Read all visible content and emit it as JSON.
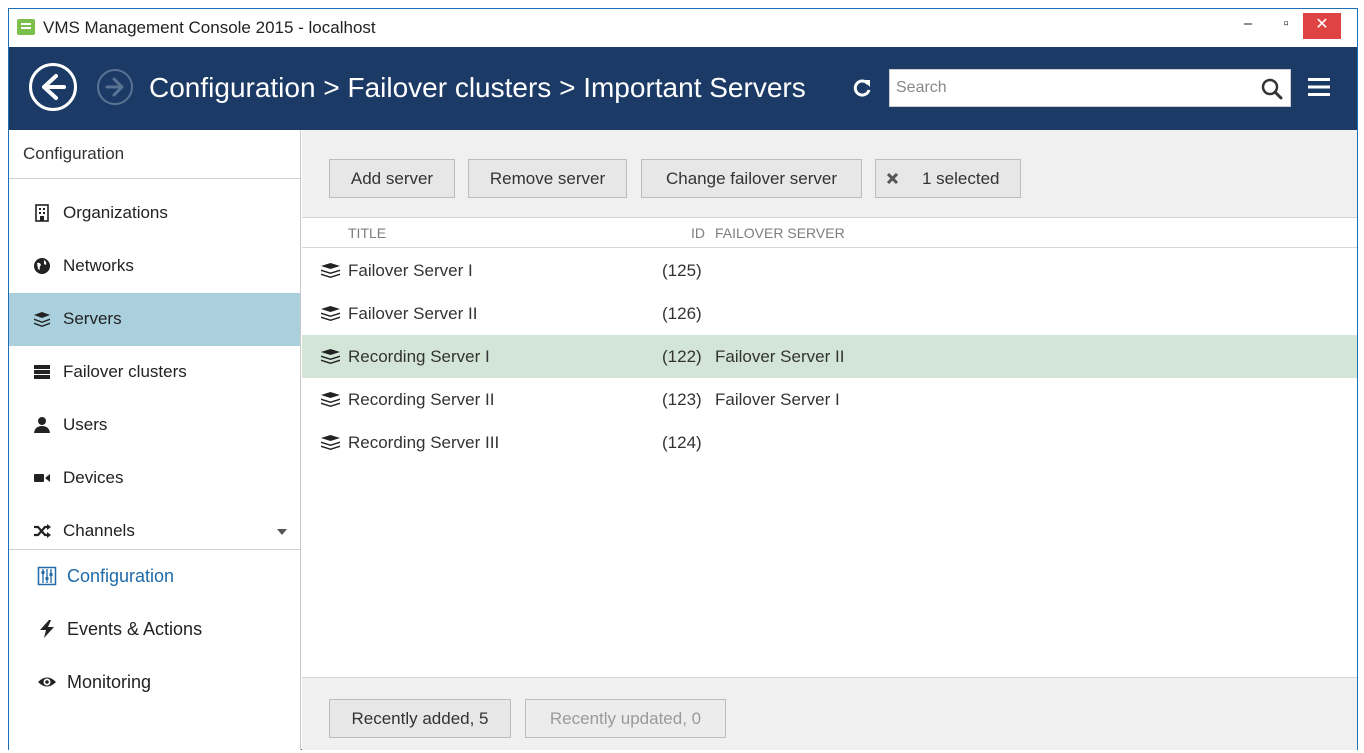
{
  "window": {
    "title": "VMS Management Console 2015 - localhost",
    "minimize_symbol": "–",
    "maximize_symbol": "▫",
    "close_symbol": "✕"
  },
  "header": {
    "breadcrumb": "Configuration > Failover clusters > Important Servers",
    "search_placeholder": "Search",
    "search_value": ""
  },
  "sidebar": {
    "heading": "Configuration",
    "items": [
      {
        "label": "Organizations",
        "icon": "building-icon"
      },
      {
        "label": "Networks",
        "icon": "globe-icon"
      },
      {
        "label": "Servers",
        "icon": "servers-stack-icon",
        "active": true
      },
      {
        "label": "Failover clusters",
        "icon": "failover-cluster-icon"
      },
      {
        "label": "Users",
        "icon": "user-icon"
      },
      {
        "label": "Devices",
        "icon": "camera-icon"
      },
      {
        "label": "Channels",
        "icon": "shuffle-icon"
      }
    ],
    "sections": [
      {
        "label": "Configuration",
        "icon": "configuration-icon",
        "active": true
      },
      {
        "label": "Events & Actions",
        "icon": "lightning-icon"
      },
      {
        "label": "Monitoring",
        "icon": "eye-icon"
      }
    ]
  },
  "toolbar": {
    "add_label": "Add server",
    "remove_label": "Remove server",
    "change_label": "Change failover server",
    "selected_label": "1 selected"
  },
  "table": {
    "columns": {
      "title": "TITLE",
      "id": "ID",
      "failover": "FAILOVER SERVER"
    },
    "rows": [
      {
        "title": "Failover Server I",
        "id": "(125)",
        "failover": ""
      },
      {
        "title": "Failover Server II",
        "id": "(126)",
        "failover": ""
      },
      {
        "title": "Recording Server I",
        "id": "(122)",
        "failover": "Failover Server II",
        "selected": true
      },
      {
        "title": "Recording Server II",
        "id": "(123)",
        "failover": "Failover Server I"
      },
      {
        "title": "Recording Server III",
        "id": "(124)",
        "failover": ""
      }
    ]
  },
  "footer": {
    "recently_added": "Recently added, 5",
    "recently_updated": "Recently updated, 0"
  },
  "colors": {
    "header_bg": "#1b3a66",
    "active_sidebar": "#a9d0dc",
    "selected_row": "#d2e5d6",
    "close_button": "#e04343",
    "active_section_text": "#1f6aa8"
  }
}
